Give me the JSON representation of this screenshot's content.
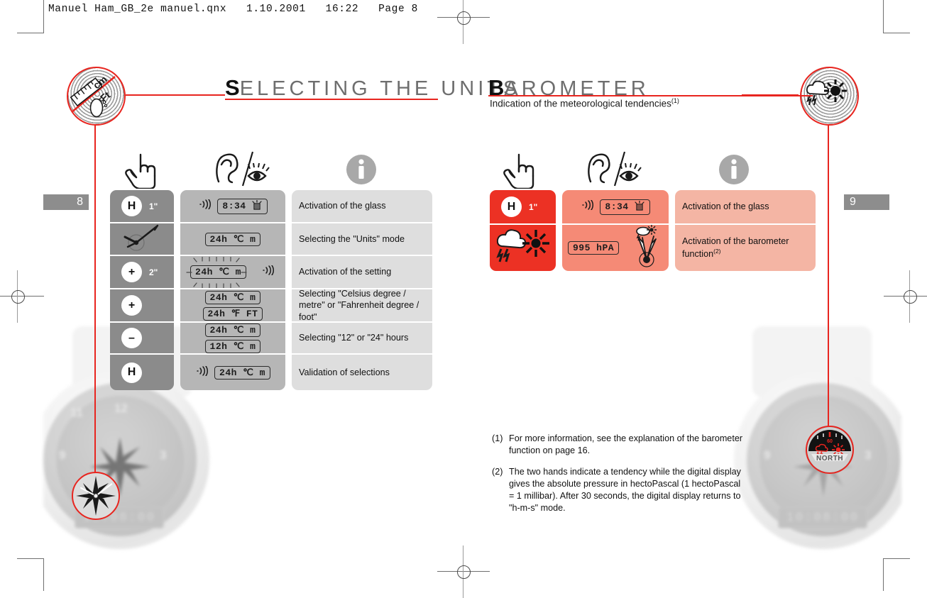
{
  "proof": {
    "header": "Manuel Ham_GB_2e manuel.qnx   1.10.2001   16:22   Page 8"
  },
  "colors": {
    "accent_red": "#e8251f",
    "table_red_dark": "#ec3124",
    "table_red_mid": "#f58a76",
    "table_red_light": "#f4b5a4",
    "table_gray_dark": "#8b8b8b",
    "table_gray_mid": "#b6b6b6",
    "table_gray_light": "#dedede"
  },
  "left_page": {
    "page_number": "8",
    "title_lead": "S",
    "title_rest": "ELECTING THE UNITS",
    "corner_icon_name": "units-cm-ft-foot-icon",
    "corner_icon_labels": {
      "metric": "cm",
      "imperial": "Ft"
    },
    "pictograms": [
      {
        "name": "hand-press-icon",
        "label": "press"
      },
      {
        "name": "ear-slash-eye-icon",
        "label": "hear / see"
      },
      {
        "name": "info-icon",
        "label": "i"
      }
    ],
    "rows": [
      {
        "pusher": "H",
        "pusher_name": "pusher-h",
        "duration": "1\"",
        "display": {
          "beep": true,
          "text": "8:34",
          "glass": true
        },
        "description": "Activation of the glass"
      },
      {
        "pusher": "",
        "pusher_name": "watch-hands-icon",
        "duration": "",
        "display": {
          "beep": false,
          "text": "24h ℃ m"
        },
        "description": "Selecting the  \"Units\" mode"
      },
      {
        "pusher": "+",
        "pusher_name": "pusher-plus",
        "duration": "2\"",
        "display": {
          "beep": true,
          "text": "24h ℃ m",
          "blinking": true
        },
        "description": "Activation of the setting"
      },
      {
        "pusher": "+",
        "pusher_name": "pusher-plus",
        "duration": "",
        "display_stack": [
          "24h ℃ m",
          "24h ℉ FT"
        ],
        "description": "Selecting \"Celsius degree / metre\" or \"Fahrenheit degree / foot\""
      },
      {
        "pusher": "–",
        "pusher_name": "pusher-minus",
        "duration": "",
        "display_stack": [
          "24h ℃ m",
          "12h ℃ m"
        ],
        "description": "Selecting \"12\" or \"24\" hours"
      },
      {
        "pusher": "H",
        "pusher_name": "pusher-h",
        "duration": "",
        "display": {
          "beep": true,
          "text": "24h ℃ m"
        },
        "description": "Validation of selections"
      }
    ],
    "watch_lcd": "10:08:00"
  },
  "right_page": {
    "page_number": "9",
    "title_lead": "B",
    "title_rest": "AROMETER",
    "subtitle": "Indication of the meteorological tendencies",
    "subtitle_ref": "(1)",
    "corner_icon_name": "barometer-weather-icon",
    "bezel_callout_label": "NORTH",
    "bezel_callout_value": "60",
    "pictograms": [
      {
        "name": "hand-press-icon",
        "label": "press"
      },
      {
        "name": "ear-slash-eye-icon",
        "label": "hear / see"
      },
      {
        "name": "info-icon",
        "label": "i"
      }
    ],
    "rows": [
      {
        "pusher": "H",
        "pusher_name": "pusher-h",
        "duration": "1\"",
        "display": {
          "beep": true,
          "text": "8:34",
          "glass": true
        },
        "description": "Activation of the glass"
      },
      {
        "pusher": "",
        "pusher_name": "weather-cloud-sun-icon",
        "duration": "",
        "display": {
          "beep": false,
          "text": "995 hPA",
          "hands": true
        },
        "description": "Activation of the barometer function",
        "description_ref": "(2)"
      }
    ],
    "footnotes": [
      {
        "num": "(1)",
        "text": "For more information, see the explanation of the barometer function on page 16."
      },
      {
        "num": "(2)",
        "text": "The two hands indicate a tendency while the digital display gives the absolute pressure in hectoPascal (1 hectoPascal = 1 millibar). After 30 seconds, the digital display returns to \"h-m-s\" mode."
      }
    ],
    "watch_lcd": "10:08:00"
  }
}
